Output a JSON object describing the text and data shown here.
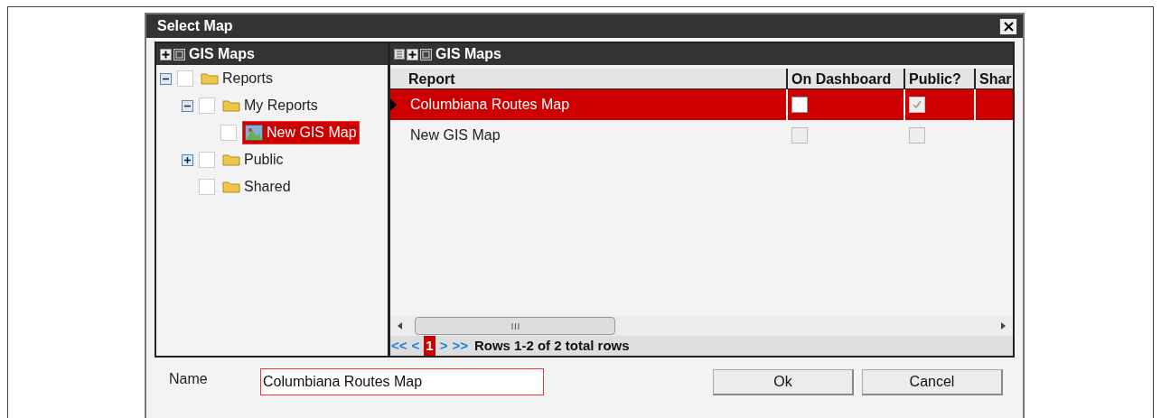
{
  "window": {
    "title": "Select Map"
  },
  "tree_panel": {
    "title": "GIS Maps",
    "items": [
      {
        "label": "Reports",
        "kind": "folder",
        "expanded": true,
        "checked": false,
        "selected": false,
        "children": [
          {
            "label": "My Reports",
            "kind": "folder",
            "expanded": true,
            "checked": false,
            "selected": false,
            "children": [
              {
                "label": "New GIS Map",
                "kind": "map",
                "checked": false,
                "selected": true
              }
            ]
          },
          {
            "label": "Public",
            "kind": "folder",
            "expanded": false,
            "checked": false,
            "selected": false
          },
          {
            "label": "Shared",
            "kind": "folder",
            "checked": false,
            "selected": false
          }
        ]
      }
    ]
  },
  "grid_panel": {
    "title": "GIS Maps",
    "columns": [
      "Report",
      "On Dashboard",
      "Public?",
      "Shar"
    ],
    "rows": [
      {
        "report": "Columbiana Routes Map",
        "selected": true,
        "on_dashboard": {
          "checked": false,
          "disabled": false
        },
        "public": {
          "checked": true,
          "disabled": true
        }
      },
      {
        "report": "New GIS Map",
        "selected": false,
        "on_dashboard": {
          "checked": false,
          "disabled": true
        },
        "public": {
          "checked": false,
          "disabled": true
        }
      }
    ],
    "pager": {
      "first": "<<",
      "prev": "<",
      "pages": [
        {
          "label": "1",
          "selected": true
        }
      ],
      "next": ">",
      "last": ">>",
      "status": "Rows 1-2 of 2 total rows"
    }
  },
  "name_field": {
    "label": "Name",
    "value": "Columbiana Routes Map"
  },
  "buttons": [
    "Ok",
    "Cancel"
  ]
}
